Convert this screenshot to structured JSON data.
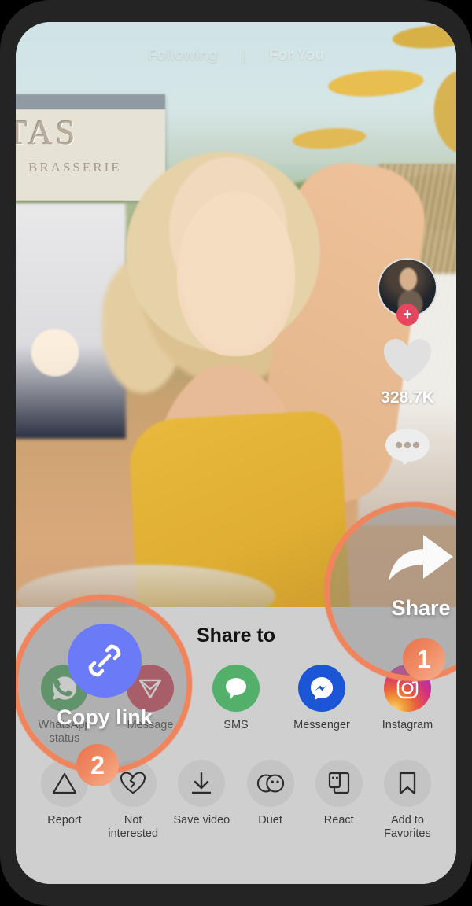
{
  "app": {
    "screen_name": "tiktok-video-share-sheet"
  },
  "video": {
    "top_nav": {
      "following_label": "Following",
      "divider": "|",
      "for_you_label": "For You"
    },
    "sign_text_line1": "TAS",
    "sign_text_line2": "BRASSERIE"
  },
  "action_rail": {
    "avatar_name": "creator-avatar",
    "follow_plus": "+",
    "like_count": "328.7K",
    "like_icon": "heart-icon",
    "comment_icon": "comment-dots-icon"
  },
  "annotations": {
    "share": {
      "label": "Share",
      "badge": "1",
      "ring_color": "#f0845c"
    },
    "copy_link": {
      "label": "Copy link",
      "badge": "2",
      "icon": "link-chain-icon",
      "circle_color": "#6b7bf7",
      "ring_color": "#f0845c"
    }
  },
  "share_sheet": {
    "title": "Share to",
    "apps": [
      {
        "label": "WhatsApp status",
        "icon": "whatsapp-icon",
        "color": "#3f9c52"
      },
      {
        "label": "Message",
        "icon": "message-icon",
        "color": "#c0394b"
      },
      {
        "label": "SMS",
        "icon": "sms-icon",
        "color": "#53b06a"
      },
      {
        "label": "Messenger",
        "icon": "messenger-icon",
        "color": "#1a56d6"
      },
      {
        "label": "Instagram",
        "icon": "instagram-icon",
        "color": "#d6307c"
      }
    ],
    "actions": [
      {
        "label": "Report",
        "icon": "warning-triangle-icon"
      },
      {
        "label": "Not interested",
        "icon": "broken-heart-icon"
      },
      {
        "label": "Save video",
        "icon": "download-icon"
      },
      {
        "label": "Duet",
        "icon": "duet-circles-icon"
      },
      {
        "label": "React",
        "icon": "react-frames-icon"
      },
      {
        "label": "Add to Favorites",
        "icon": "bookmark-icon"
      }
    ]
  },
  "theme": {
    "sheet_bg": "#cfcfcf",
    "frame_bg": "#242424",
    "accent": "#f0845c"
  }
}
